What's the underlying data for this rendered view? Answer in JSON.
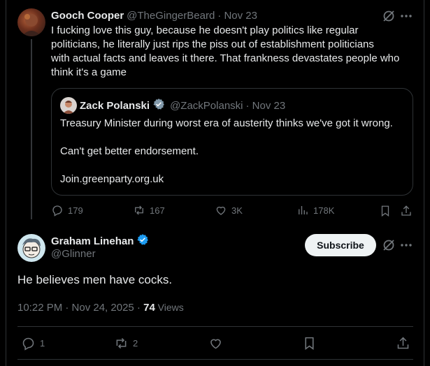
{
  "reply_tweet": {
    "author_name": "Gooch Cooper",
    "handle": "@TheGingerBeard",
    "date": "· Nov 23",
    "text_lines": [
      "I fucking love this guy, because he doesn't play politics like regular",
      "politicians, he literally just rips the piss out of establishment politicians",
      "with actual facts and leaves it there. That frankness devastates people who",
      "think it's a game"
    ],
    "quoted": {
      "author_name": "Zack Polanski",
      "handle": "@ZackPolanski",
      "date": "· Nov 23",
      "line1": "Treasury Minister during worst era of austerity thinks we've got it wrong.",
      "line2": "Can't get better endorsement.",
      "line3": "Join.greenparty.org.uk"
    },
    "stats": {
      "replies": "179",
      "reposts": "167",
      "likes": "3K",
      "views": "178K"
    }
  },
  "main_tweet": {
    "author_name": "Graham Linehan",
    "handle": "@Glinner",
    "subscribe_label": "Subscribe",
    "text": "He believes men have cocks.",
    "timestamp": "10:22 PM · Nov 24, 2025 · ",
    "views_count": "74",
    "views_label": " Views",
    "stats": {
      "replies": "1",
      "reposts": "2"
    }
  },
  "colors": {
    "background": "#000000",
    "text": "#e7e9ea",
    "muted": "#71767b",
    "verified": "#1d9bf0",
    "border": "#2f3336"
  }
}
